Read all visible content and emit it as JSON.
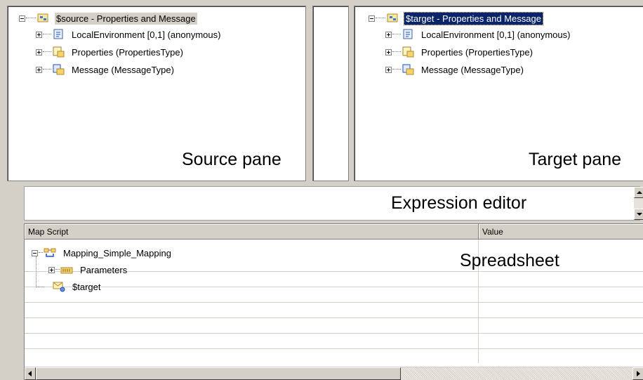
{
  "source_pane": {
    "root_label": "$source - Properties and Message",
    "children": [
      {
        "label": "LocalEnvironment [0,1] (anonymous)",
        "icon": "local-environment-icon"
      },
      {
        "label": "Properties (PropertiesType)",
        "icon": "properties-icon"
      },
      {
        "label": "Message (MessageType)",
        "icon": "message-icon"
      }
    ],
    "caption": "Source pane"
  },
  "target_pane": {
    "root_label": "$target - Properties and Message",
    "children": [
      {
        "label": "LocalEnvironment [0,1] (anonymous)",
        "icon": "local-environment-icon"
      },
      {
        "label": "Properties (PropertiesType)",
        "icon": "properties-icon"
      },
      {
        "label": "Message (MessageType)",
        "icon": "message-icon"
      }
    ],
    "caption": "Target pane"
  },
  "expression_editor": {
    "caption": "Expression editor"
  },
  "spreadsheet": {
    "columns": [
      "Map Script",
      "Value"
    ],
    "rows": [
      {
        "label": "Mapping_Simple_Mapping",
        "icon": "mapping-icon"
      },
      {
        "label": "Parameters",
        "icon": "parameters-icon"
      },
      {
        "label": "$target",
        "icon": "target-message-icon"
      }
    ],
    "caption": "Spreadsheet"
  },
  "colors": {
    "selection": "#0a246a",
    "chrome": "#d4d0c8"
  }
}
